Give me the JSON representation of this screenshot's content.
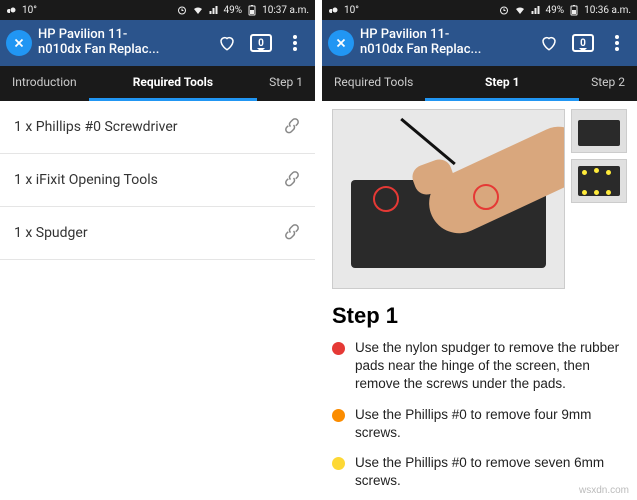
{
  "statusBar": {
    "temp": "10°",
    "battery": "49%",
    "timeLeft": "10:37 a.m.",
    "timeRight": "10:36 a.m."
  },
  "appBar": {
    "titleLine1": "HP Pavilion 11-",
    "titleLine2": "n010dx Fan Replac...",
    "commentCount": "0"
  },
  "leftTabs": {
    "left": "Introduction",
    "center": "Required Tools",
    "right": "Step 1"
  },
  "rightTabs": {
    "left": "Required Tools",
    "center": "Step 1",
    "right": "Step 2"
  },
  "tools": {
    "items": [
      {
        "label": "1 x Phillips #0 Screwdriver"
      },
      {
        "label": "1 x iFixit Opening Tools"
      },
      {
        "label": "1 x Spudger"
      }
    ]
  },
  "step": {
    "heading": "Step 1",
    "bullets": [
      {
        "color": "#e53935",
        "text": "Use the nylon spudger to remove the rubber pads near the hinge of the screen, then remove the screws under the pads."
      },
      {
        "color": "#fb8c00",
        "text": "Use the Phillips #0 to remove four 9mm screws."
      },
      {
        "color": "#fdd835",
        "text": "Use the Phillips #0 to remove seven 6mm screws."
      }
    ]
  },
  "watermark": "wsxdn.com"
}
